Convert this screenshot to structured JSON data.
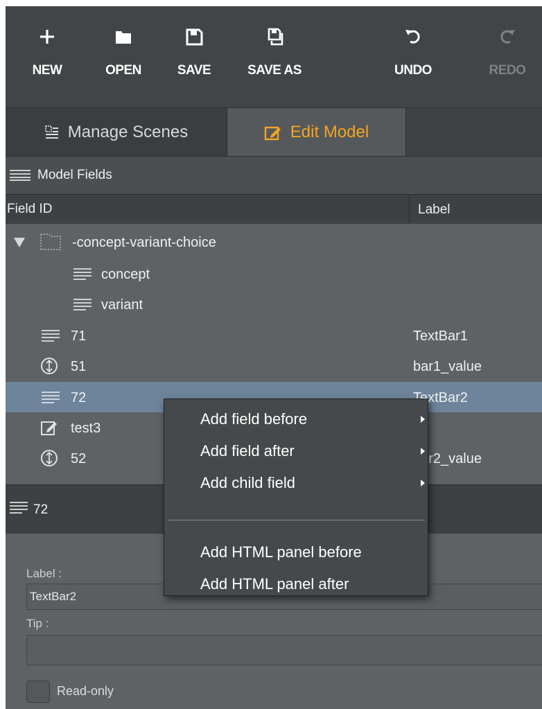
{
  "toolbar": {
    "new_label": "NEW",
    "open_label": "OPEN",
    "save_label": "SAVE",
    "save_as_label": "SAVE AS",
    "undo_label": "UNDO",
    "redo_label": "REDO"
  },
  "tabs": {
    "manage_scenes": "Manage Scenes",
    "edit_model": "Edit Model",
    "active": "edit_model"
  },
  "model_fields": {
    "title": "Model Fields",
    "columns": {
      "field_id": "Field ID",
      "label": "Label"
    },
    "rows": [
      {
        "id": "-concept-variant-choice",
        "label": "",
        "icon": "folder-icon",
        "expanded": true
      },
      {
        "id": "concept",
        "label": "",
        "icon": "text-lines-icon"
      },
      {
        "id": "variant",
        "label": "",
        "icon": "text-lines-icon"
      },
      {
        "id": "71",
        "label": "TextBar1",
        "icon": "text-lines-icon"
      },
      {
        "id": "51",
        "label": "bar1_value",
        "icon": "numeric-icon"
      },
      {
        "id": "72",
        "label": "TextBar2",
        "icon": "text-lines-icon",
        "selected": true
      },
      {
        "id": "test3",
        "label": "",
        "icon": "edit-icon"
      },
      {
        "id": "52",
        "label": "bar2_value",
        "icon": "numeric-icon"
      }
    ]
  },
  "properties": {
    "title": "72",
    "label_caption": "Label :",
    "label_value": "TextBar2",
    "tip_caption": "Tip :",
    "tip_value": "",
    "readonly_label": "Read-only"
  },
  "context_menu": {
    "items": [
      {
        "label": "Add field before",
        "submenu": true
      },
      {
        "label": "Add field after",
        "submenu": true
      },
      {
        "label": "Add child field",
        "submenu": true
      },
      {
        "label": "Add HTML panel before",
        "submenu": false
      },
      {
        "label": "Add HTML panel after",
        "submenu": false
      }
    ]
  },
  "colors": {
    "accent": "#f4a420",
    "toolbar_bg": "#414547",
    "panel_bg": "#5f6264",
    "selected_row": "#6e849b"
  }
}
